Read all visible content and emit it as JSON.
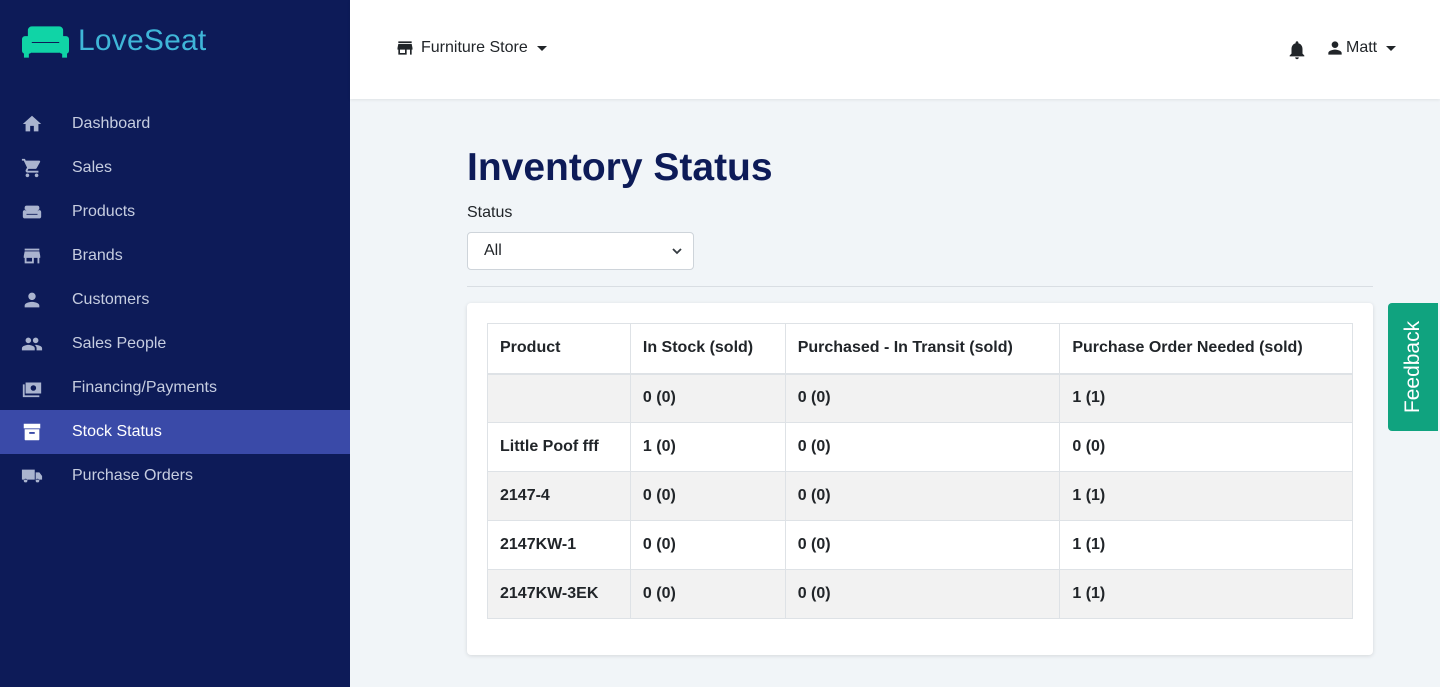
{
  "brand": {
    "name": "LoveSeat",
    "logo_color": "#10d4a6"
  },
  "sidebar": {
    "items": [
      {
        "label": "Dashboard",
        "icon": "home-icon"
      },
      {
        "label": "Sales",
        "icon": "cart-icon"
      },
      {
        "label": "Products",
        "icon": "sofa-icon"
      },
      {
        "label": "Brands",
        "icon": "store-icon"
      },
      {
        "label": "Customers",
        "icon": "person-icon"
      },
      {
        "label": "Sales People",
        "icon": "people-icon"
      },
      {
        "label": "Financing/Payments",
        "icon": "money-icon"
      },
      {
        "label": "Stock Status",
        "icon": "archive-icon",
        "active": true
      },
      {
        "label": "Purchase Orders",
        "icon": "truck-icon"
      }
    ]
  },
  "topbar": {
    "store": "Furniture Store",
    "user": "Matt"
  },
  "main": {
    "title": "Inventory Status",
    "status_label": "Status",
    "status_value": "All",
    "table": {
      "headers": [
        "Product",
        "In Stock (sold)",
        "Purchased - In Transit (sold)",
        "Purchase Order Needed (sold)"
      ],
      "rows": [
        [
          "",
          "0 (0)",
          "0 (0)",
          "1 (1)"
        ],
        [
          "Little Poof fff",
          "1 (0)",
          "0 (0)",
          "0 (0)"
        ],
        [
          "2147-4",
          "0 (0)",
          "0 (0)",
          "1 (1)"
        ],
        [
          "2147KW-1",
          "0 (0)",
          "0 (0)",
          "1 (1)"
        ],
        [
          "2147KW-3EK",
          "0 (0)",
          "0 (0)",
          "1 (1)"
        ]
      ]
    }
  },
  "feedback": {
    "label": "Feedback",
    "color": "#10a37f"
  },
  "colors": {
    "sidebar": "#0d1b58",
    "active": "#3a4aa8",
    "brand_text": "#3fb6d8"
  }
}
